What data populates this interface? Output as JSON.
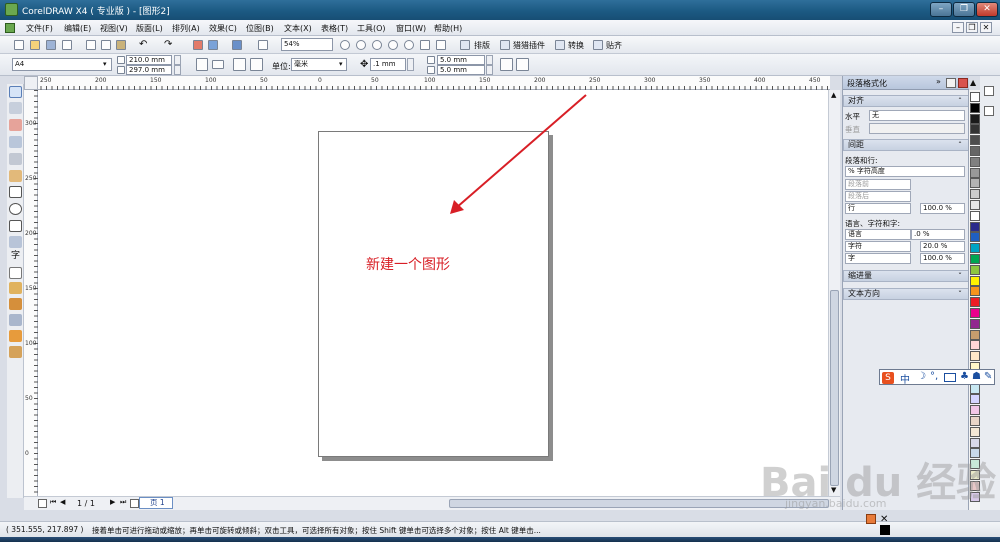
{
  "title_bar": {
    "title": "CorelDRAW X4 ( 专业版 ) - [图形2]",
    "minimize_label": "–",
    "restore_label": "❐",
    "close_label": "✕"
  },
  "menu": {
    "items": [
      "文件(F)",
      "编辑(E)",
      "视图(V)",
      "版面(L)",
      "排列(A)",
      "效果(C)",
      "位图(B)",
      "文本(X)",
      "表格(T)",
      "工具(O)",
      "窗口(W)",
      "帮助(H)"
    ]
  },
  "standard_toolbar": {
    "zoom_value": "54%",
    "layout_label": "排版",
    "plugins_label": "猎猎插件",
    "convert_label": "转换",
    "paste_label": "贴齐"
  },
  "property_bar": {
    "paper_size": "A4",
    "width_value": "210.0 mm",
    "height_value": "297.0 mm",
    "units_label": "单位:",
    "units_value": "毫米",
    "nudge_value": ".1 mm",
    "dup_x_value": "5.0 mm",
    "dup_y_value": "5.0 mm"
  },
  "ruler": {
    "h_ticks": [
      "250",
      "200",
      "150",
      "100",
      "50",
      "0",
      "50",
      "100",
      "150",
      "200",
      "250",
      "300",
      "350",
      "400",
      "450"
    ],
    "v_ticks": [
      "300",
      "250",
      "200",
      "150",
      "100",
      "50",
      "0"
    ]
  },
  "canvas": {
    "annotation_text": "新建一个图形",
    "annotation_color": "#d81f26"
  },
  "docker": {
    "title": "段落格式化",
    "align_section": "对齐",
    "horizontal_label": "水平",
    "horizontal_value": "无",
    "vertical_label": "垂直",
    "spacing_section": "间距",
    "para_line_label": "段落和行:",
    "char_height_value": "% 字符高度",
    "before_para_label": "段落前",
    "after_para_label": "段落后",
    "line_label": "行",
    "line_value": "100.0 %",
    "lang_char_word_label": "语言、字符和字:",
    "language_label": "语言",
    "language_value": ".0 %",
    "character_label": "字符",
    "character_value": "20.0 %",
    "word_label": "字",
    "word_value": "100.0 %",
    "indent_section": "缩进量",
    "text_direction_section": "文本方向"
  },
  "page_navigator": {
    "page_count": "1 / 1",
    "page_tab": "页 1"
  },
  "status_bar": {
    "coordinates": "( 351.555, 217.897 )",
    "hint": "接着单击可进行拖动或缩放；再单击可旋转或倾斜；双击工具，可选择所有对象；按住 Shift 键单击可选择多个对象；按住 Alt 键单击..."
  },
  "ime_bar": {
    "mode_label": "中"
  },
  "watermark": {
    "text": "Bai du 经验",
    "url": "jingyan.baidu.com"
  },
  "palette": {
    "colors": [
      "#ffffff",
      "#000000",
      "#1a1a1a",
      "#333333",
      "#4d4d4d",
      "#666666",
      "#808080",
      "#999999",
      "#b3b3b3",
      "#cccccc",
      "#e6e6e6",
      "#ffffff",
      "#2b2b8a",
      "#1f5fc0",
      "#00a3c4",
      "#00a651",
      "#8dc63f",
      "#fff200",
      "#f7941d",
      "#ed1c24",
      "#ec008c",
      "#92278f",
      "#c69c6d",
      "#ffd5d5",
      "#ffe8c8",
      "#fff6c8",
      "#e0f2c8",
      "#c8e8f2",
      "#d5d5ff",
      "#f2c8e8",
      "#e8d5c8",
      "#f5e8d5",
      "#d8d8e8",
      "#c8d8e8",
      "#c8e8d8",
      "#e8e8c8",
      "#e8c8c8",
      "#d8c8e8"
    ]
  }
}
